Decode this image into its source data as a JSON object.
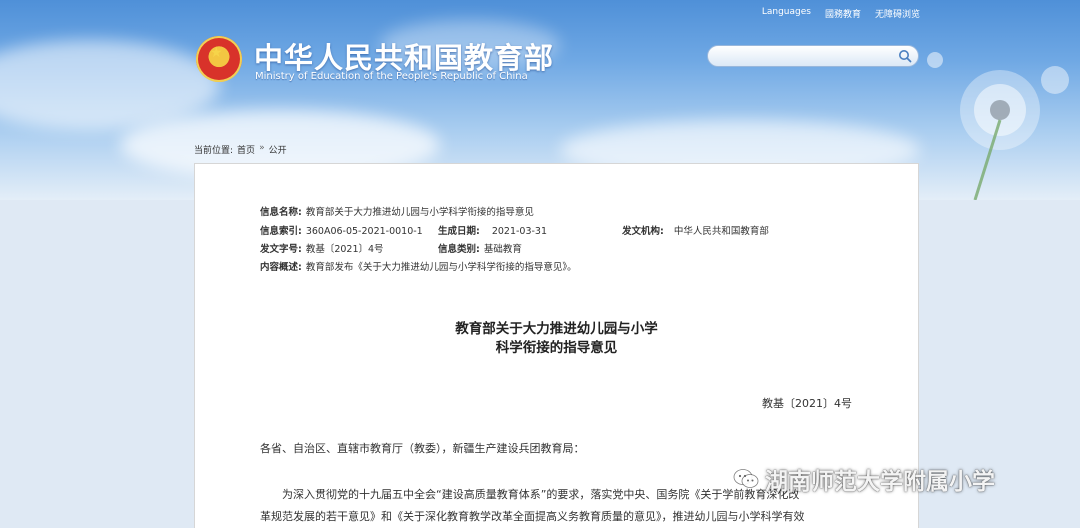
{
  "header": {
    "top_links": [
      "Languages",
      "國務教育",
      "无障碍浏览"
    ],
    "site_title": "中华人民共和国教育部",
    "site_subtitle": "Ministry of Education of the People's Republic of China",
    "search_placeholder": ""
  },
  "breadcrumb": {
    "label": "当前位置:",
    "items": [
      "首页",
      "公开"
    ],
    "separator": "»"
  },
  "meta": {
    "name_key": "信息名称:",
    "name_val": "教育部关于大力推进幼儿园与小学科学衔接的指导意见",
    "index_key": "信息索引:",
    "index_val": "360A06-05-2021-0010-1",
    "date_key": "生成日期:",
    "date_val": "2021-03-31",
    "org_key": "发文机构:",
    "org_val": "中华人民共和国教育部",
    "doc_key": "发文字号:",
    "doc_val": "教基〔2021〕4号",
    "cat_key": "信息类别:",
    "cat_val": "基础教育",
    "summary_key": "内容概述:",
    "summary_val": "教育部发布《关于大力推进幼儿园与小学科学衔接的指导意见》。"
  },
  "document": {
    "title_line1": "教育部关于大力推进幼儿园与小学",
    "title_line2": "科学衔接的指导意见",
    "doc_number": "教基〔2021〕4号",
    "salutation": "各省、自治区、直辖市教育厅（教委），新疆生产建设兵团教育局：",
    "para1_line1": "为深入贯彻党的十九届五中全会“建设高质量教育体系”的要求，落实党中央、国务院《关于学前教育深化改",
    "para1_line2": "革规范发展的若干意见》和《关于深化教育教学改革全面提高义务教育质量的意见》，推进幼儿园与小学科学有效"
  },
  "watermark": {
    "text": "湖南师范大学附属小学"
  },
  "colors": {
    "sky_top": "#4f90d8",
    "panel_bg": "#ffffff",
    "text": "#333333"
  }
}
